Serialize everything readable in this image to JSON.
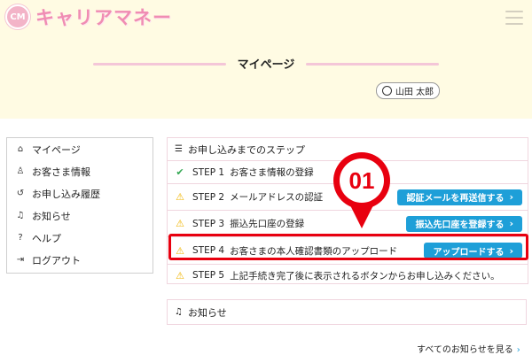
{
  "header": {
    "app_name": "キャリアマネー",
    "logo_badge": "CM",
    "page_title": "マイページ",
    "user_name": "山田 太郎"
  },
  "sidebar": {
    "items": [
      {
        "label": "マイページ",
        "icon": "home-icon"
      },
      {
        "label": "お客さま情報",
        "icon": "user-icon"
      },
      {
        "label": "お申し込み履歴",
        "icon": "history-icon"
      },
      {
        "label": "お知らせ",
        "icon": "bell-icon"
      },
      {
        "label": "ヘルプ",
        "icon": "help-icon"
      },
      {
        "label": "ログアウト",
        "icon": "logout-icon"
      }
    ]
  },
  "steps": {
    "heading": "お申し込みまでのステップ",
    "items": [
      {
        "step": "STEP 1",
        "label": "お客さま情報の登録",
        "status": "done",
        "button": ""
      },
      {
        "step": "STEP 2",
        "label": "メールアドレスの認証",
        "status": "warning",
        "button": "認証メールを再送信する"
      },
      {
        "step": "STEP 3",
        "label": "振込先口座の登録",
        "status": "warning",
        "button": "振込先口座を登録する"
      },
      {
        "step": "STEP 4",
        "label": "お客さまの本人確認書類のアップロード",
        "status": "warning",
        "button": "アップロードする"
      },
      {
        "step": "STEP 5",
        "label": "上記手続き完了後に表示されるボタンからお申し込みください。",
        "status": "warning",
        "button": ""
      }
    ]
  },
  "callout": {
    "number": "01"
  },
  "notice": {
    "heading": "お知らせ",
    "all_link": "すべてのお知らせを見る"
  },
  "colors": {
    "brand_pink": "#f08db3",
    "accent_blue": "#1e9fd8",
    "highlight_red": "#e8000f",
    "header_bg": "#fffbe3"
  }
}
